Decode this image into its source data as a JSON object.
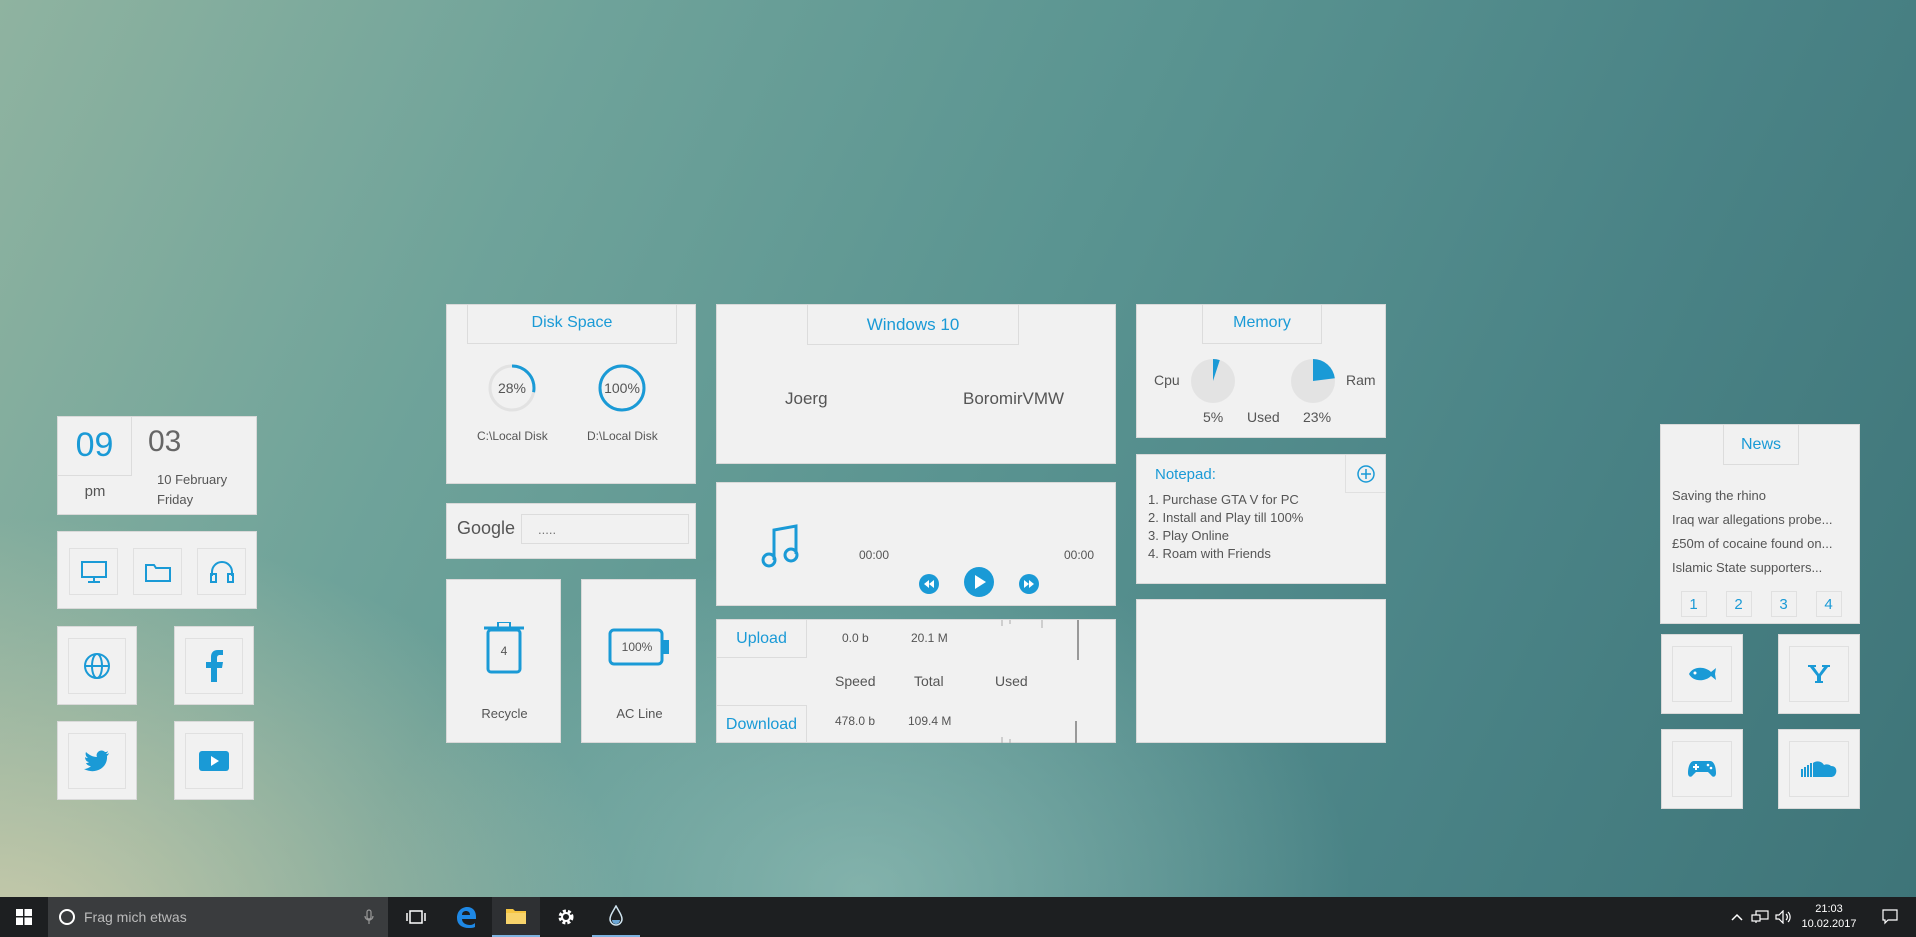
{
  "clock": {
    "hour": "09",
    "minute": "03",
    "ampm": "pm",
    "date": "10 February",
    "weekday": "Friday"
  },
  "disk": {
    "title": "Disk Space",
    "drives": [
      {
        "percent_label": "28%",
        "percent": 28,
        "label": "C:\\Local Disk"
      },
      {
        "percent_label": "100%",
        "percent": 100,
        "label": "D:\\Local Disk"
      }
    ]
  },
  "google": {
    "label": "Google",
    "placeholder": "....."
  },
  "recycle": {
    "count": "4",
    "label": "Recycle"
  },
  "battery": {
    "percent_label": "100%",
    "label": "AC Line"
  },
  "windows": {
    "title": "Windows 10",
    "user": "Joerg",
    "computer": "BoromirVMW"
  },
  "player": {
    "time_start": "00:00",
    "time_end": "00:00"
  },
  "network": {
    "upload_label": "Upload",
    "download_label": "Download",
    "upload_speed": "0.0 b",
    "upload_total": "20.1 M",
    "download_speed": "478.0 b",
    "download_total": "109.4 M",
    "col_speed": "Speed",
    "col_total": "Total",
    "col_used": "Used"
  },
  "memory": {
    "title": "Memory",
    "cpu_label": "Cpu",
    "ram_label": "Ram",
    "cpu_value": "5%",
    "cpu_percent": 5,
    "used_label": "Used",
    "ram_value": "23%",
    "ram_percent": 23
  },
  "notepad": {
    "title": "Notepad:",
    "items": [
      "1. Purchase GTA V for PC",
      "2. Install and Play till 100%",
      "3. Play Online",
      "4. Roam with Friends"
    ]
  },
  "news": {
    "title": "News",
    "items": [
      "Saving the rhino",
      "Iraq war allegations probe...",
      "£50m of cocaine found on...",
      "Islamic State supporters..."
    ],
    "pages": [
      "1",
      "2",
      "3",
      "4"
    ]
  },
  "taskbar": {
    "search_placeholder": "Frag mich etwas",
    "time": "21:03",
    "date": "10.02.2017"
  },
  "colors": {
    "accent": "#1a9ad6",
    "panel": "#f1f1f1",
    "taskbar": "#1d1f21"
  }
}
